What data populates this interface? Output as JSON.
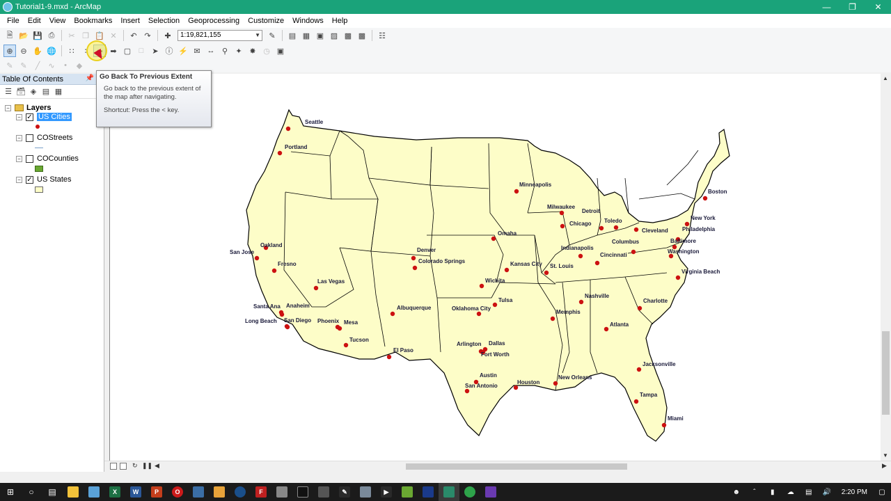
{
  "window": {
    "title": "Tutorial1-9.mxd - ArcMap"
  },
  "menu": [
    "File",
    "Edit",
    "View",
    "Bookmarks",
    "Insert",
    "Selection",
    "Geoprocessing",
    "Customize",
    "Windows",
    "Help"
  ],
  "toolbar": {
    "scale": "1:19,821,155"
  },
  "toc": {
    "title": "Table Of Contents",
    "root": "Layers",
    "layers": [
      {
        "name": "US Cities",
        "checked": true,
        "selected": true,
        "symbol": "red-point"
      },
      {
        "name": "COStreets",
        "checked": false,
        "selected": false,
        "symbol": "line"
      },
      {
        "name": "COCounties",
        "checked": false,
        "selected": false,
        "symbol": "green-fill"
      },
      {
        "name": "US States",
        "checked": true,
        "selected": false,
        "symbol": "yellow-fill"
      }
    ]
  },
  "tooltip": {
    "title": "Go Back To Previous Extent",
    "line1": "Go back to the previous extent of",
    "line2": "the map after navigating.",
    "shortcut": "Shortcut: Press the < key."
  },
  "map": {
    "state_fill": "#fdfdc8",
    "city_color": "#cc1111",
    "label_color": "#1a1a3a",
    "cities": [
      "Seattle",
      "Portland",
      "Minneapolis",
      "Boston",
      "Milwaukee",
      "Detroit",
      "New York",
      "Chicago",
      "Toledo",
      "Cleveland",
      "Philadelphia",
      "Omaha",
      "Baltimore",
      "Oakland",
      "Columbus",
      "Washington",
      "Indianapolis",
      "San Jose",
      "Denver",
      "Cincinnati",
      "Fresno",
      "Colorado Springs",
      "Kansas City",
      "St. Louis",
      "Virginia Beach",
      "Las Vegas",
      "Wichita",
      "Nashville",
      "Santa Ana",
      "Anaheim",
      "Tulsa",
      "Charlotte",
      "Albuquerque",
      "Oklahoma City",
      "Memphis",
      "Long Beach",
      "San Diego",
      "Phoenix",
      "Mesa",
      "Atlanta",
      "Tucson",
      "Arlington",
      "Dallas",
      "El Paso",
      "Fort Worth",
      "Jacksonville",
      "Austin",
      "New Orleans",
      "Houston",
      "San Antonio",
      "Tampa",
      "Miami"
    ]
  },
  "taskbar": {
    "time": "2:20 PM"
  }
}
